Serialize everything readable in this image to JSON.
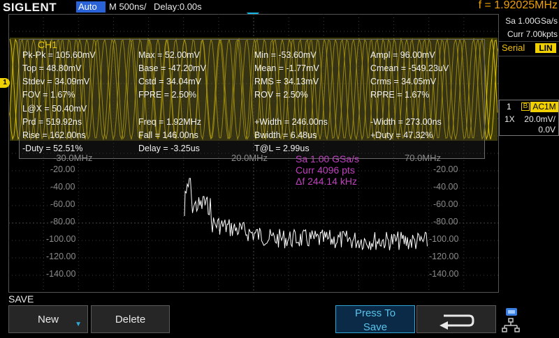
{
  "topbar": {
    "logo": "SIGLENT",
    "mode": "Auto",
    "timebase": "M 500ns/",
    "delay": "Delay:0.00s",
    "freq_counter": "f = 1.92025MHz"
  },
  "acquisition": {
    "sample_rate": "Sa 1.00GSa/s",
    "memory": "Curr 7.00kpts",
    "serial_label": "Serial",
    "serial_mode": "LIN"
  },
  "channel": {
    "number": "1",
    "bw_limit": "B",
    "coupling": "AC1M",
    "probe": "1X",
    "scale": "20.0mV/",
    "offset": "0.0V"
  },
  "measure": {
    "title": "CH1",
    "rows": [
      [
        "Pk-Pk = 105.60mV",
        "Max = 52.00mV",
        "Min = -53.60mV",
        "Ampl = 96.00mV"
      ],
      [
        "Top = 48.80mV",
        "Base = -47.20mV",
        "Mean = -1.77mV",
        "Cmean = -549.23uV"
      ],
      [
        "Stdev = 34.09mV",
        "Cstd = 34.04mV",
        "RMS = 34.13mV",
        "Crms = 34.05mV"
      ],
      [
        "FOV = 1.67%",
        "FPRE = 2.50%",
        "ROV = 2.50%",
        "RPRE = 1.67%"
      ],
      [
        "L@X = 50.40mV",
        "",
        "",
        ""
      ],
      [
        "Prd = 519.92ns",
        "Freq = 1.92MHz",
        "+Width = 246.00ns",
        "-Width = 273.00ns"
      ],
      [
        "Rise = 162.00ns",
        "Fall = 146.00ns",
        "Bwidth = 6.48us",
        "+Duty = 47.32%"
      ],
      [
        "-Duty = 52.51%",
        "Delay = -3.25us",
        "T@L = 2.99us",
        ""
      ]
    ]
  },
  "fft": {
    "freq_labels": [
      "-30.0MHz",
      "20.0MHz",
      "70.0MHz"
    ],
    "db_labels": [
      "-20.00",
      "-40.00",
      "-60.00",
      "-80.00",
      "-100.00",
      "-120.00",
      "-140.00"
    ],
    "info_sample": "Sa 1.00 GSa/s",
    "info_points": "Curr 4096 pts",
    "info_df": "Δf 244.14 kHz"
  },
  "menu": {
    "title": "SAVE",
    "new_label": "New",
    "delete_label": "Delete",
    "press_label": "Press To",
    "save_label": "Save"
  },
  "colors": {
    "ch1": "#f0d000",
    "fft_info": "#c040c0",
    "accent": "#2fa8d8",
    "freq_counter": "#f0a000"
  }
}
